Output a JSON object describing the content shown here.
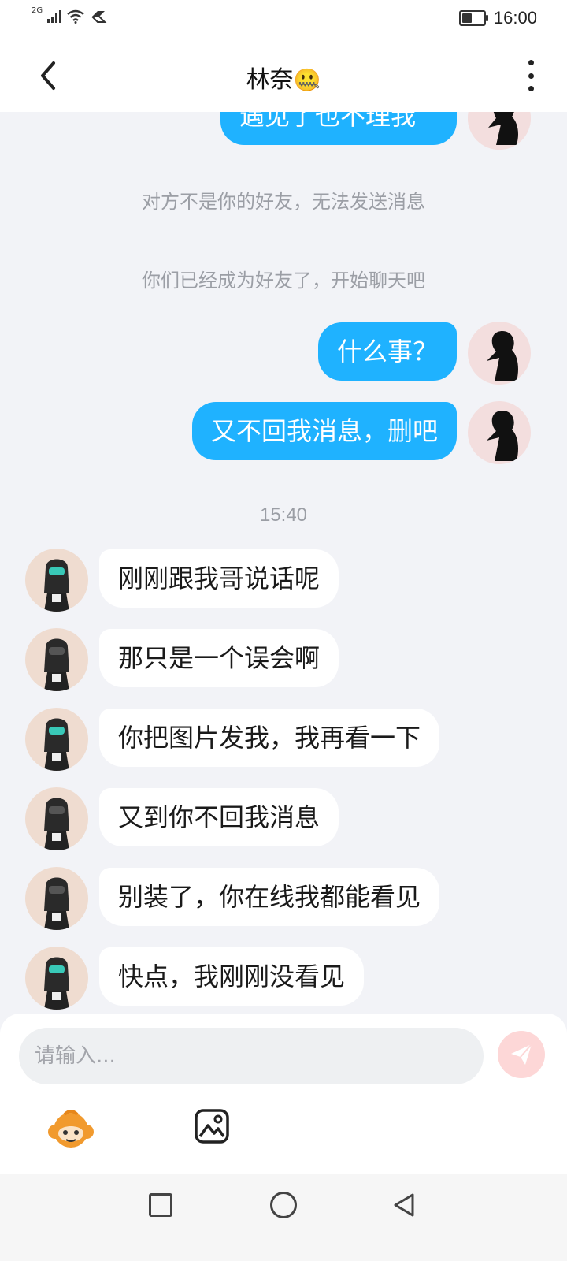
{
  "status_bar": {
    "network": "2G",
    "time": "16:00",
    "battery_level": 0.45
  },
  "header": {
    "title": "林奈",
    "title_emoji": "🤐"
  },
  "messages_top_partial": "遇见了也不理我",
  "system_messages": [
    "对方不是你的好友，无法发送消息",
    "你们已经成为好友了，开始聊天吧"
  ],
  "outgoing": [
    "什么事？",
    "又不回我消息，删吧"
  ],
  "timestamp": "15:40",
  "incoming": [
    "刚刚跟我哥说话呢",
    "那只是一个误会啊",
    "你把图片发我，我再看一下",
    "又到你不回我消息",
    "别装了，你在线我都能看见",
    "快点，我刚刚没看见"
  ],
  "input": {
    "placeholder": "请输入..."
  },
  "colors": {
    "accent": "#1fb2ff",
    "background": "#f2f3f7",
    "send_button": "#fdd7d7"
  },
  "icons": [
    "back-icon",
    "more-icon",
    "send-icon",
    "emoji-icon",
    "image-icon",
    "recent-apps-icon",
    "home-icon",
    "nav-back-icon"
  ]
}
